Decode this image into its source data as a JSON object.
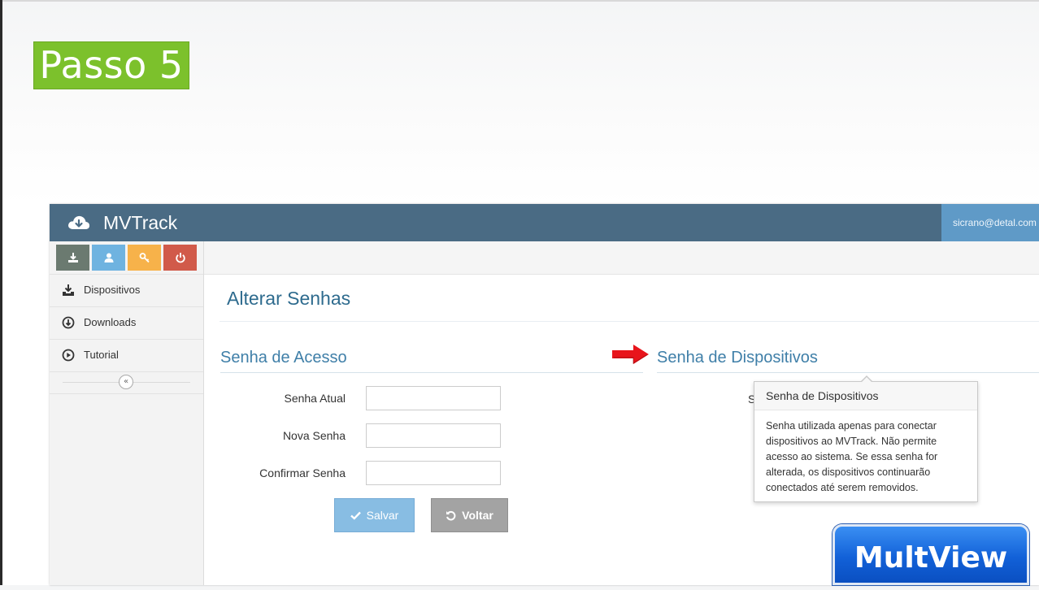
{
  "overlay": {
    "step_label": "Passo 5",
    "watermark": "MultView"
  },
  "header": {
    "brand": "MVTrack",
    "brand_icon": "cloud-download-icon",
    "user_email": "sicrano@detal.com"
  },
  "sidebar": {
    "shortcuts": [
      {
        "icon": "download-icon",
        "color": "#6b7a70"
      },
      {
        "icon": "user-icon",
        "color": "#6fb3e0"
      },
      {
        "icon": "key-icon",
        "color": "#f7b24a"
      },
      {
        "icon": "power-icon",
        "color": "#d15a4a"
      }
    ],
    "items": [
      {
        "label": "Dispositivos",
        "icon": "download-tray-icon"
      },
      {
        "label": "Downloads",
        "icon": "circle-download-icon"
      },
      {
        "label": "Tutorial",
        "icon": "play-circle-icon"
      }
    ],
    "collapse_icon": "double-chevron-left-icon"
  },
  "main": {
    "page_title": "Alterar Senhas",
    "access_section": {
      "title": "Senha de Acesso",
      "fields": [
        {
          "label": "Senha Atual",
          "value": ""
        },
        {
          "label": "Nova Senha",
          "value": ""
        },
        {
          "label": "Confirmar Senha",
          "value": ""
        }
      ],
      "save_label": "Salvar",
      "back_label": "Voltar"
    },
    "devices_section": {
      "title": "Senha de Dispositivos",
      "field_label_partial": "S"
    },
    "popover": {
      "title": "Senha de Dispositivos",
      "body": "Senha utilizada apenas para conectar dispositivos ao MVTrack. Não permite acesso ao sistema. Se essa senha for alterada, os dispositivos continuarão conectados até serem removidos."
    }
  },
  "colors": {
    "topbar": "#4a6b84",
    "accent": "#3f7fa8",
    "step_badge": "#7cc12c",
    "pointer_arrow": "#e8141b"
  }
}
